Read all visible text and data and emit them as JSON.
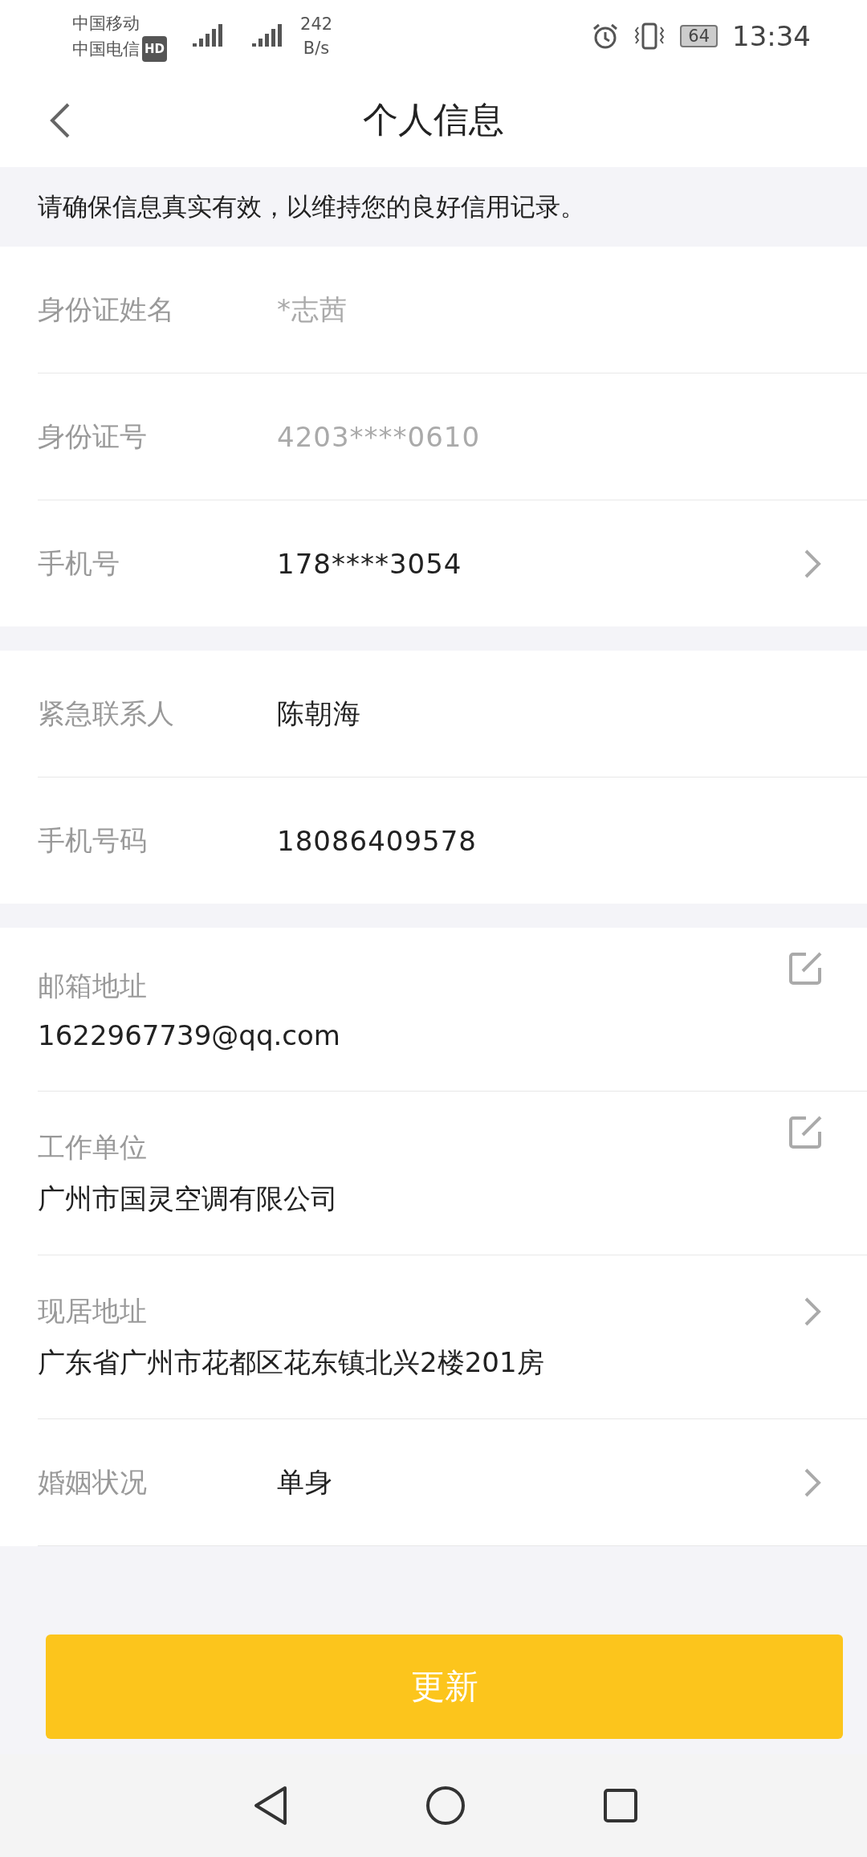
{
  "status_bar": {
    "carriers": [
      "中国移动",
      "中国电信"
    ],
    "hd_badge": "HD",
    "net_speed": "242",
    "net_unit": "B/s",
    "battery": "64",
    "time": "13:34"
  },
  "header": {
    "title": "个人信息"
  },
  "notice": "请确保信息真实有效，以维持您的良好信用记录。",
  "sections": [
    {
      "rows": [
        {
          "kind": "inline",
          "label": "身份证姓名",
          "value": "*志茜",
          "disabled": true
        },
        {
          "kind": "inline",
          "label": "身份证号",
          "value": "4203****0610",
          "disabled": true
        },
        {
          "kind": "inline",
          "label": "手机号",
          "value": "178****3054",
          "disabled": false,
          "trailing": {
            "kind": "chevron"
          }
        }
      ]
    },
    {
      "rows": [
        {
          "kind": "inline",
          "label": "紧急联系人",
          "value": "陈朝海",
          "disabled": false
        },
        {
          "kind": "inline",
          "label": "手机号码",
          "value": "18086409578",
          "disabled": false
        }
      ]
    },
    {
      "rows": [
        {
          "kind": "stacked",
          "label": "邮箱地址",
          "value": "1622967739@qq.com",
          "disabled": false,
          "trailing": {
            "kind": "edit"
          }
        },
        {
          "kind": "stacked",
          "label": "工作单位",
          "value": "广州市国灵空调有限公司",
          "disabled": false,
          "trailing": {
            "kind": "edit"
          }
        },
        {
          "kind": "stacked",
          "label": "现居地址",
          "value": "广东省广州市花都区花东镇北兴2楼201房",
          "disabled": false,
          "trailing": {
            "kind": "chevron"
          }
        },
        {
          "kind": "inline",
          "label": "婚姻状况",
          "value": "单身",
          "disabled": false,
          "trailing": {
            "kind": "chevron"
          }
        }
      ]
    }
  ],
  "button": "更新"
}
